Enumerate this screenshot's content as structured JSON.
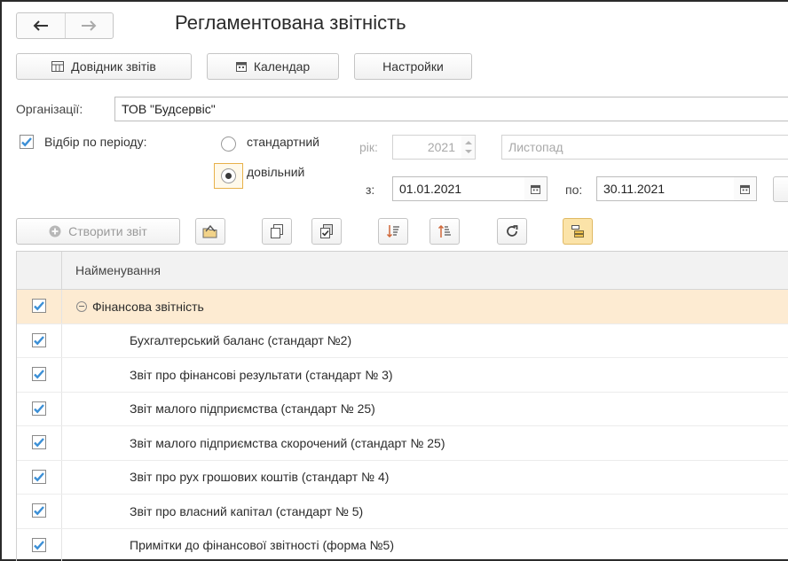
{
  "title": "Регламентована звітність",
  "nav": {
    "back_icon": "arrow-left-icon",
    "forward_icon": "arrow-right-icon"
  },
  "toolbar": {
    "reports_directory": "Довідник звітів",
    "calendar": "Календар",
    "settings": "Настройки"
  },
  "organization": {
    "label": "Організації:",
    "value": "ТОВ \"Будсервіс\""
  },
  "period_filter": {
    "checkbox_label": "Відбір по періоду:",
    "checked": true,
    "standard_label": "стандартний",
    "custom_label": "довільний",
    "selected": "довільний",
    "year_label": "рік:",
    "year_value": "2021",
    "month_value": "Листопад",
    "from_label": "з:",
    "from_value": "01.01.2021",
    "to_label": "по:",
    "to_value": "30.11.2021"
  },
  "actions": {
    "create_report": "Створити звіт",
    "icons": [
      "open-folder-icon",
      "copy-icon",
      "copy-checked-icon",
      "sort-descending-icon",
      "sort-ascending-icon",
      "refresh-icon",
      "group-toggle-icon"
    ]
  },
  "table": {
    "column_header": "Найменування",
    "group": {
      "name": "Фінансова звітність",
      "checked": true
    },
    "rows": [
      {
        "name": "Бухгалтерський баланс (стандарт №2)",
        "checked": true
      },
      {
        "name": "Звіт про фінансові результати (стандарт № 3)",
        "checked": true
      },
      {
        "name": "Звіт малого підприємства (стандарт № 25)",
        "checked": true
      },
      {
        "name": "Звіт малого підприємства скорочений (стандарт № 25)",
        "checked": true
      },
      {
        "name": "Звіт про рух грошових коштів (стандарт № 4)",
        "checked": true
      },
      {
        "name": "Звіт про власний капітал (стандарт № 5)",
        "checked": true
      },
      {
        "name": "Примітки до фінансової звітності (форма №5)",
        "checked": true
      }
    ]
  },
  "colors": {
    "accent": "#3b8fd6",
    "group_row": "#fdebd2",
    "pressed": "#fbe3a8"
  }
}
